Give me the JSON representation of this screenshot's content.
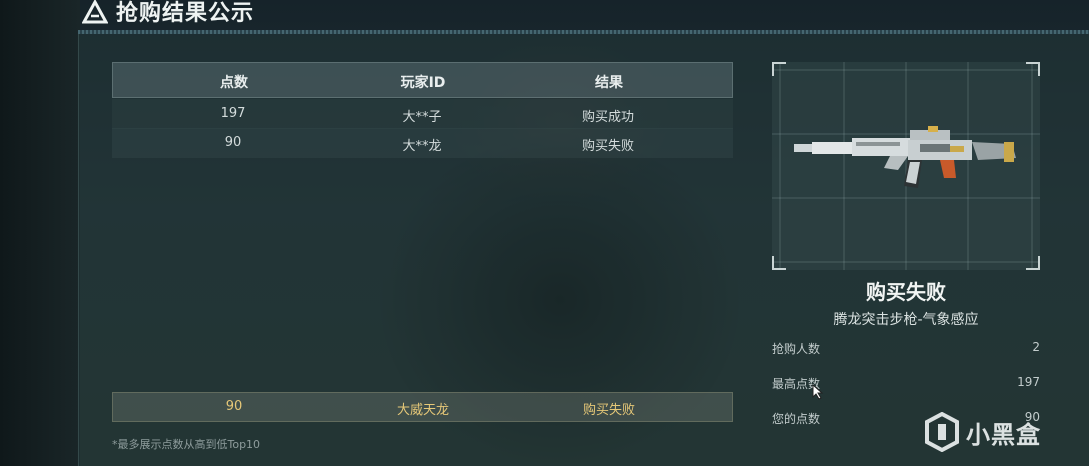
{
  "header": {
    "title": "抢购结果公示"
  },
  "table": {
    "columns": [
      "点数",
      "玩家ID",
      "结果"
    ],
    "rows": [
      {
        "points": "197",
        "player": "大**子",
        "result": "购买成功"
      },
      {
        "points": "90",
        "player": "大**龙",
        "result": "购买失败"
      }
    ],
    "own_row": {
      "points": "90",
      "player": "大威天龙",
      "result": "购买失败"
    },
    "footnote": "*最多展示点数从高到低Top10"
  },
  "result_panel": {
    "status": "购买失败",
    "item_name": "腾龙突击步枪-气象感应",
    "stats": [
      {
        "label": "抢购人数",
        "value": "2"
      },
      {
        "label": "最高点数",
        "value": "197"
      },
      {
        "label": "您的点数",
        "value": "90"
      }
    ]
  },
  "watermark": {
    "text": "小黑盒"
  },
  "colors": {
    "highlight": "#e6c878",
    "text": "#e9eeee",
    "panel": "#223638"
  }
}
